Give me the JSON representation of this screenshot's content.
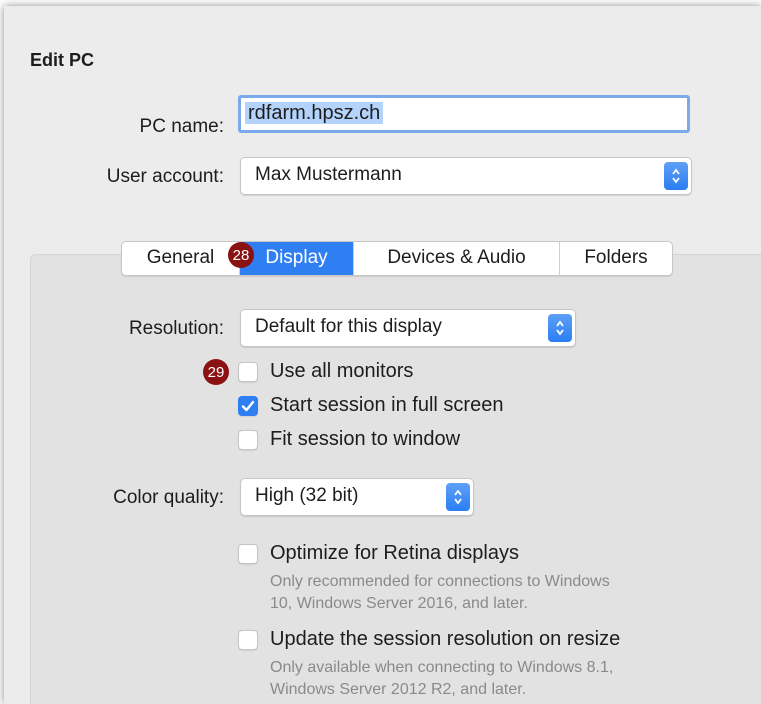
{
  "dialog": {
    "title": "Edit PC",
    "pc_name": {
      "label": "PC name:",
      "value": "rdfarm.hpsz.ch"
    },
    "user_account": {
      "label": "User account:",
      "value": "Max Mustermann"
    }
  },
  "tabs": [
    {
      "label": "General",
      "active": false
    },
    {
      "label": "Display",
      "active": true
    },
    {
      "label": "Devices & Audio",
      "active": false
    },
    {
      "label": "Folders",
      "active": false
    }
  ],
  "badges": {
    "tab_display": "28",
    "use_all_monitors": "29"
  },
  "display": {
    "resolution": {
      "label": "Resolution:",
      "value": "Default for this display"
    },
    "checkboxes": [
      {
        "label": "Use all monitors",
        "checked": false
      },
      {
        "label": "Start session in full screen",
        "checked": true
      },
      {
        "label": "Fit session to window",
        "checked": false
      }
    ],
    "color_quality": {
      "label": "Color quality:",
      "value": "High (32 bit)"
    },
    "retina": {
      "label": "Optimize for Retina displays",
      "checked": false,
      "note_line1": "Only recommended for connections to Windows",
      "note_line2": "10, Windows Server 2016, and later."
    },
    "update_resolution": {
      "label": "Update the session resolution on resize",
      "checked": false,
      "note_line1": "Only available when connecting to Windows 8.1,",
      "note_line2": "Windows Server 2012 R2, and later."
    }
  },
  "colors": {
    "accent": "#2f7ff3",
    "badge": "#8b1212",
    "focus_ring": "#7aa9ec"
  }
}
